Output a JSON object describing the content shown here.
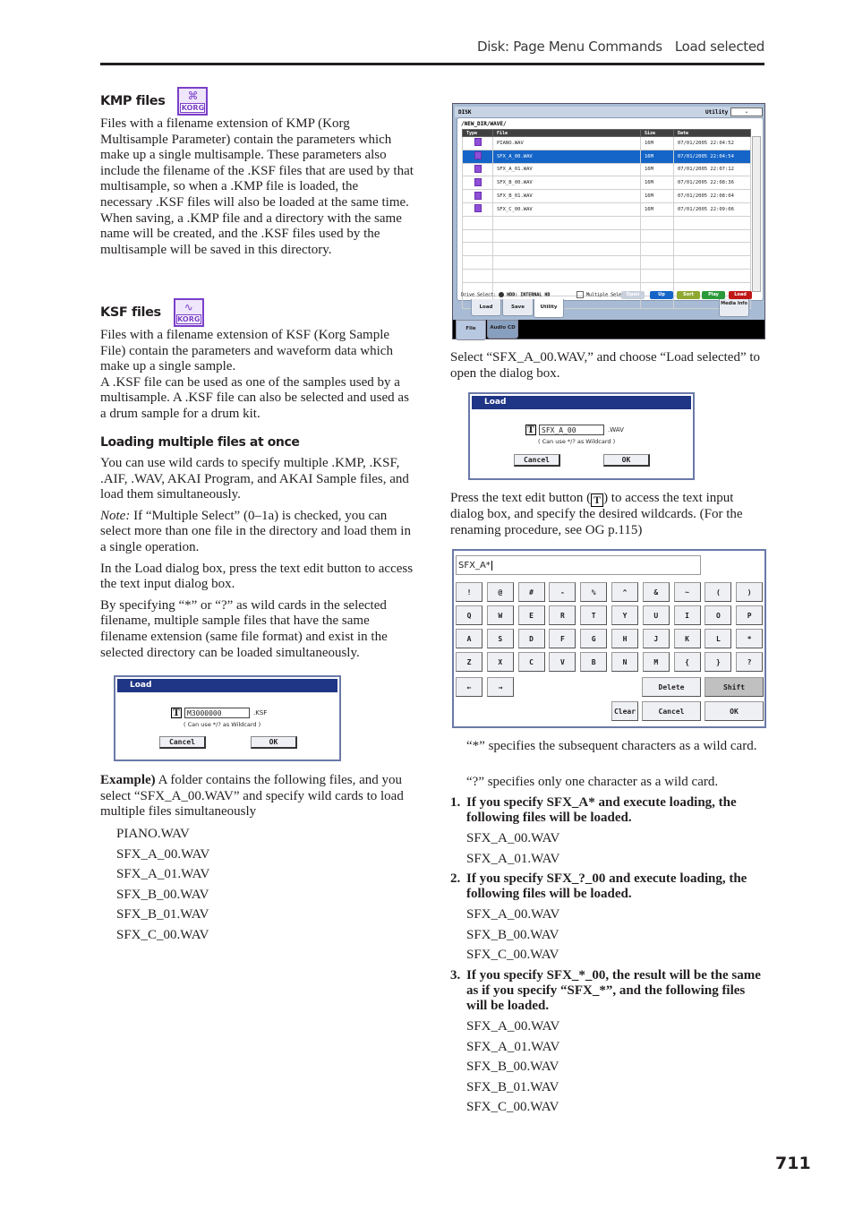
{
  "header": {
    "section": "Disk: Page Menu Commands",
    "command": "Load selected"
  },
  "page_number": "711",
  "left": {
    "kmp": {
      "heading": "KMP files",
      "icon": "korg-multisample-icon",
      "body": "Files with a filename extension of KMP (Korg Multisample Parameter) contain the parameters which make up a single multisample. These parameters also include the filename of the .KSF files that are used by that multisample, so when a .KMP file is loaded, the necessary .KSF files will also be loaded at the same time.",
      "body2": "When saving, a .KMP file and a directory with the same name will be created, and the .KSF files used by the multisample will be saved in this directory."
    },
    "ksf": {
      "heading": "KSF files",
      "icon": "korg-sample-icon",
      "body": "Files with a filename extension of KSF (Korg Sample File) contain the parameters and waveform data which make up a single sample.",
      "body2": "A .KSF file can be used as one of the samples used by a multisample. A .KSF file can also be selected and used as a drum sample for a drum kit."
    },
    "multi": {
      "heading": "Loading multiple files at once",
      "p1": "You can use wild cards to specify multiple .KMP, .KSF, .AIF, .WAV, AKAI Program, and AKAI Sample files, and load them simultaneously.",
      "note_label": "Note:",
      "note": " If “Multiple Select” (0–1a) is checked, you can select more than one file in the directory and load them in a single operation.",
      "p2": "In the Load dialog box, press the text edit button to access the text input dialog box.",
      "p3": "By specifying “*” or “?” as wild cards in the selected filename, multiple sample files that have the same filename extension (same file format) and exist in the selected directory can be loaded simultaneously."
    },
    "dialog_ksf": {
      "title": "Load",
      "t_button": "T",
      "value": "M3000000",
      "ext": ".KSF",
      "hint": "( Can use */? as Wildcard )",
      "cancel": "Cancel",
      "ok": "OK"
    },
    "example": {
      "label": "Example)",
      "text": " A folder contains the following files, and you select “SFX_A_00.WAV” and specify wild cards to load multiple files simultaneously",
      "files": [
        "PIANO.WAV",
        "SFX_A_00.WAV",
        "SFX_A_01.WAV",
        "SFX_B_00.WAV",
        "SFX_B_01.WAV",
        "SFX_C_00.WAV"
      ]
    }
  },
  "disk_screen": {
    "title": "DISK",
    "utility": "Utility",
    "path": "/NEW_DIR/WAVE/",
    "columns": [
      "Type",
      "File",
      "Size",
      "Date"
    ],
    "rows": [
      {
        "file": "PIANO.WAV",
        "size": "16M",
        "date": "07/01/2005 22:04:52",
        "selected": false
      },
      {
        "file": "SFX_A_00.WAV",
        "size": "16M",
        "date": "07/01/2005 22:04:54",
        "selected": true
      },
      {
        "file": "SFX_A_01.WAV",
        "size": "16M",
        "date": "07/01/2005 22:07:12",
        "selected": false
      },
      {
        "file": "SFX_B_00.WAV",
        "size": "16M",
        "date": "07/01/2005 22:08:36",
        "selected": false
      },
      {
        "file": "SFX_B_01.WAV",
        "size": "16M",
        "date": "07/01/2005 22:08:04",
        "selected": false
      },
      {
        "file": "SFX_C_00.WAV",
        "size": "16M",
        "date": "07/01/2005 22:09:06",
        "selected": false
      }
    ],
    "drive_label": "Drive Select:",
    "drive_value": "HDD: INTERNAL HD",
    "multiple_select": "Multiple Select",
    "buttons": {
      "open": "Open",
      "up": "Up",
      "sort": "Sort",
      "play": "Play",
      "load": "Load"
    },
    "colors": {
      "up": "#1565c8",
      "sort": "#8fa830",
      "play": "#2a9a3a",
      "load": "#c01818",
      "open": "#c8d0dc",
      "selection": "#1565c8"
    },
    "tabs": [
      "Load",
      "Save",
      "Utility"
    ],
    "media_info": "Media Info",
    "bottom_tabs": [
      "File",
      "Audio CD"
    ]
  },
  "right": {
    "p1": "Select “SFX_A_00.WAV,” and choose “Load selected” to open the dialog box.",
    "dialog_wav": {
      "title": "Load",
      "t_button": "T",
      "value": "SFX_A_00",
      "ext": ".WAV",
      "hint": "( Can use */? as Wildcard )",
      "cancel": "Cancel",
      "ok": "OK"
    },
    "p2a": "Press the text edit button (",
    "p2b": ") to access the text input dialog box, and specify the desired wildcards. (For the renaming procedure, see OG p.115)",
    "keyboard": {
      "input_value": "SFX_A*",
      "rows": [
        [
          "!",
          "@",
          "#",
          "-",
          "%",
          "^",
          "&",
          "~",
          "(",
          ")"
        ],
        [
          "Q",
          "W",
          "E",
          "R",
          "T",
          "Y",
          "U",
          "I",
          "O",
          "P"
        ],
        [
          "A",
          "S",
          "D",
          "F",
          "G",
          "H",
          "J",
          "K",
          "L",
          "*"
        ],
        [
          "Z",
          "X",
          "C",
          "V",
          "B",
          "N",
          "M",
          "{",
          "}",
          "?"
        ]
      ],
      "left_arrow": "←",
      "right_arrow": "→",
      "delete": "Delete",
      "shift": "Shift",
      "clear": "Clear",
      "cancel": "Cancel",
      "ok": "OK"
    },
    "star_desc": "“*” specifies the subsequent characters as a wild card.",
    "q_desc": "“?” specifies only one character as a wild card.",
    "cases": [
      {
        "num": "1.",
        "text": "If you specify SFX_A* and execute loading, the following files will be loaded.",
        "files": [
          "SFX_A_00.WAV",
          "SFX_A_01.WAV"
        ]
      },
      {
        "num": "2.",
        "text": "If you specify SFX_?_00 and execute loading, the following files will be loaded.",
        "files": [
          "SFX_A_00.WAV",
          "SFX_B_00.WAV",
          "SFX_C_00.WAV"
        ]
      },
      {
        "num": "3.",
        "text": "If you specify SFX_*_00, the result will be the same as if you specify “SFX_*”, and the following files will be loaded.",
        "files": [
          "SFX_A_00.WAV",
          "SFX_A_01.WAV",
          "SFX_B_00.WAV",
          "SFX_B_01.WAV",
          "SFX_C_00.WAV"
        ]
      }
    ]
  }
}
